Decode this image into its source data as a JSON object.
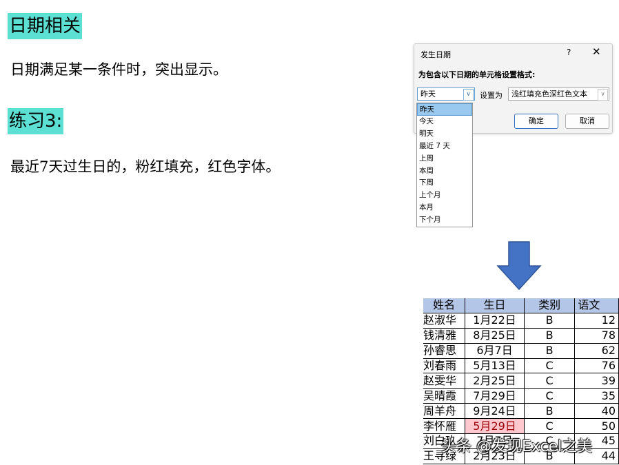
{
  "headings": {
    "date_related": "日期相关",
    "exercise": "练习3:"
  },
  "paragraphs": {
    "intro": "日期满足某一条件时，突出显示。",
    "task": "最近7天过生日的，粉红填充，红色字体。"
  },
  "dialog": {
    "title": "发生日期",
    "help": "?",
    "close": "✕",
    "instruction": "为包含以下日期的单元格设置格式:",
    "date_combo_value": "昨天",
    "set_as_label": "设置为",
    "format_combo_value": "浅红填充色深红色文本",
    "ok_label": "确定",
    "cancel_label": "取消",
    "options": [
      "昨天",
      "今天",
      "明天",
      "最近 7 天",
      "上周",
      "本周",
      "下周",
      "上个月",
      "本月",
      "下个月"
    ],
    "selected_index": 0
  },
  "arrow_color": "#4472c4",
  "table": {
    "headers": [
      "姓名",
      "生日",
      "类别",
      "语文"
    ],
    "rows": [
      [
        "赵淑华",
        "1月22日",
        "B",
        "12"
      ],
      [
        "钱清雅",
        "8月25日",
        "B",
        "78"
      ],
      [
        "孙睿思",
        "6月7日",
        "B",
        "62"
      ],
      [
        "刘春雨",
        "5月13日",
        "C",
        "76"
      ],
      [
        "赵雯华",
        "2月25日",
        "C",
        "39"
      ],
      [
        "吴晴霞",
        "7月29日",
        "C",
        "35"
      ],
      [
        "周羊舟",
        "9月24日",
        "B",
        "40"
      ],
      [
        "李怀雁",
        "5月29日",
        "C",
        "50"
      ],
      [
        "刘白玖",
        "7月7日",
        "C",
        "45"
      ],
      [
        "王寻绿",
        "2月23日",
        "B",
        "44"
      ]
    ],
    "highlight_row": 7
  },
  "watermark": "头条 @发现Excel之美",
  "colors": {
    "heading_bg": "#5ce0d3",
    "header_bg": "#b4c6e7",
    "highlight_fill": "#ffc7ce",
    "highlight_text": "#9c0006"
  }
}
